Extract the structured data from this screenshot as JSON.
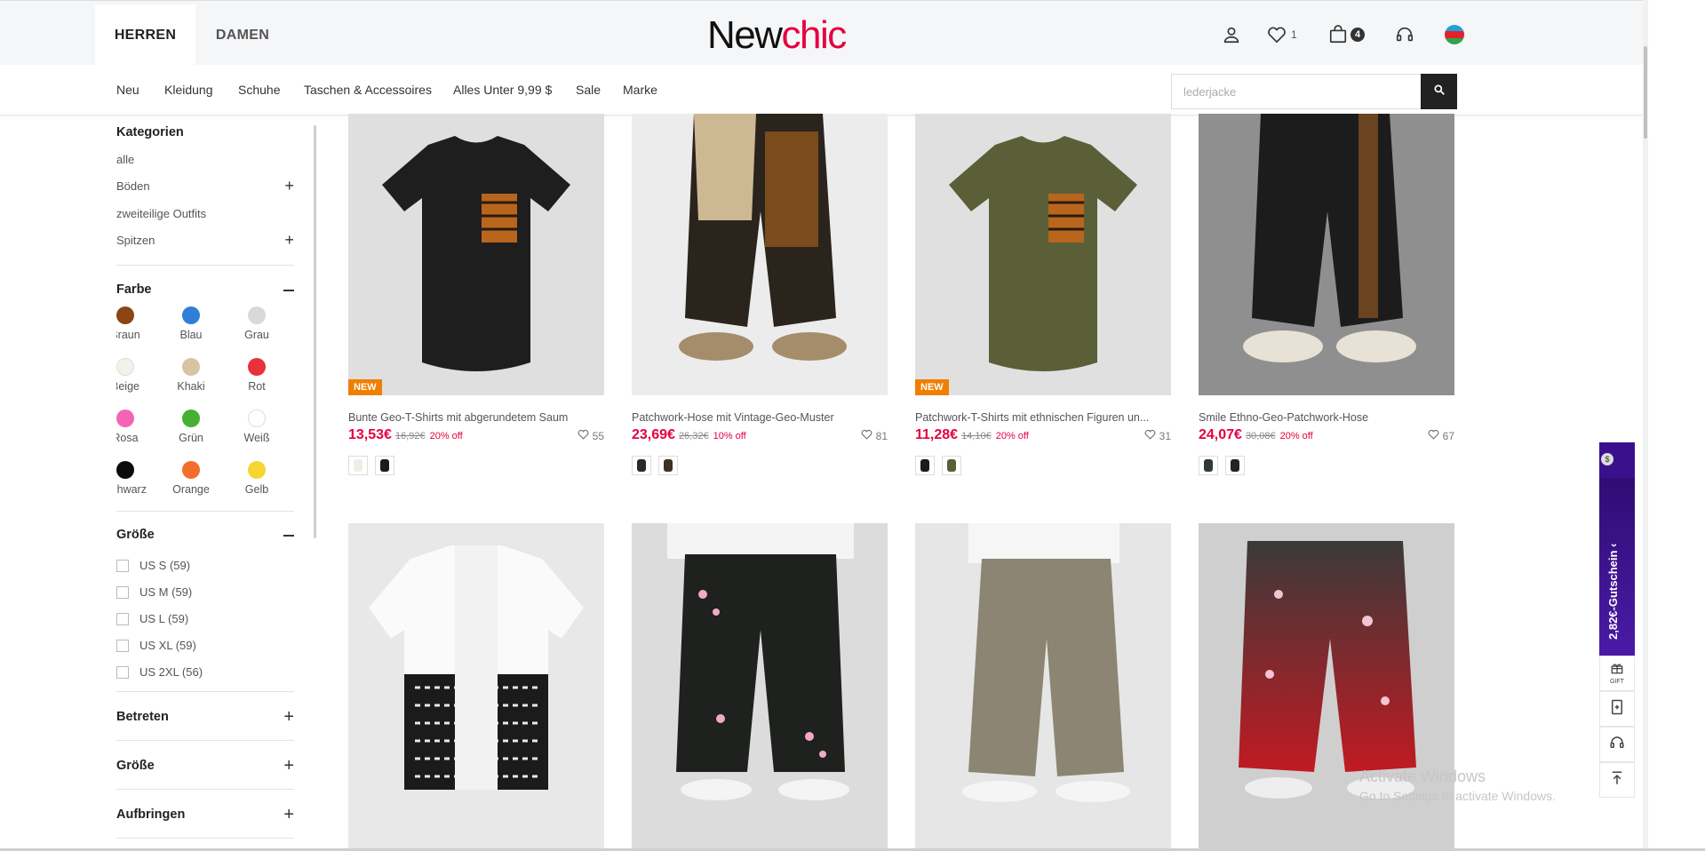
{
  "header": {
    "gender_tabs": [
      {
        "label": "HERREN",
        "active": true
      },
      {
        "label": "DAMEN",
        "active": false
      }
    ],
    "logo": {
      "part1": "New",
      "part2": "chic"
    },
    "wishlist_count": "1",
    "cart_count": "4",
    "icons": [
      "user-icon",
      "heart-icon",
      "bag-icon",
      "headset-icon",
      "flag-icon"
    ]
  },
  "nav": {
    "items": [
      "Neu",
      "Kleidung",
      "Schuhe",
      "Taschen & Accessoires",
      "Alles Unter 9,99 $",
      "Sale",
      "Marke"
    ],
    "search_placeholder": "lederjacke"
  },
  "sidebar": {
    "categories_title": "Kategorien",
    "categories": [
      {
        "label": "alle",
        "expandable": false
      },
      {
        "label": "Böden",
        "expandable": true
      },
      {
        "label": "zweiteilige Outfits",
        "expandable": false
      },
      {
        "label": "Spitzen",
        "expandable": true
      }
    ],
    "color_title": "Farbe",
    "colors": [
      {
        "label": "Braun",
        "hex": "#8b4513"
      },
      {
        "label": "Blau",
        "hex": "#2f7ed8"
      },
      {
        "label": "Grau",
        "hex": "#d9d9d9"
      },
      {
        "label": "Beige",
        "hex": "#f3f1ea"
      },
      {
        "label": "Khaki",
        "hex": "#d8c4a3"
      },
      {
        "label": "Rot",
        "hex": "#e8313b"
      },
      {
        "label": "Rosa",
        "hex": "#f564b4"
      },
      {
        "label": "Grün",
        "hex": "#46b035"
      },
      {
        "label": "Weiß",
        "hex": "#ffffff"
      },
      {
        "label": "Schwarz",
        "hex": "#0b0b0b"
      },
      {
        "label": "Orange",
        "hex": "#f36e2a"
      },
      {
        "label": "Gelb",
        "hex": "#f6d633"
      }
    ],
    "size_title": "Größe",
    "sizes": [
      "US S (59)",
      "US M (59)",
      "US L (59)",
      "US XL (59)",
      "US 2XL (56)"
    ],
    "collapsed_sections": [
      "Betreten",
      "Größe",
      "Aufbringen"
    ]
  },
  "products": [
    {
      "title": "Bunte Geo-T-Shirts mit abgerundetem Saum",
      "price": "13,53€",
      "old_price": "16,92€",
      "discount": "20% off",
      "likes": "55",
      "badge": "NEW",
      "image": "black-tshirt-tribal-pocket",
      "bg": "#dfdfdf",
      "thumbs": [
        "#f0ede6",
        "#1a1a1a"
      ]
    },
    {
      "title": "Patchwork-Hose mit Vintage-Geo-Muster",
      "price": "23,69€",
      "old_price": "26,32€",
      "discount": "10% off",
      "likes": "81",
      "badge": "",
      "image": "patchwork-jogger-pants",
      "bg": "#ececec",
      "thumbs": [
        "#2a2a2a",
        "#3b3125"
      ]
    },
    {
      "title": "Patchwork-T-Shirts mit ethnischen Figuren un...",
      "price": "11,28€",
      "old_price": "14,10€",
      "discount": "20% off",
      "likes": "31",
      "badge": "NEW",
      "image": "olive-tshirt-ethnic-pocket",
      "bg": "#e0e0e0",
      "thumbs": [
        "#1b1b1b",
        "#5b5f33"
      ]
    },
    {
      "title": "Smile Ethno-Geo-Patchwork-Hose",
      "price": "24,07€",
      "old_price": "30,08€",
      "discount": "20% off",
      "likes": "67",
      "badge": "",
      "image": "black-jogger-side-stripe",
      "bg": "#8f8f8f",
      "thumbs": [
        "#2f3a33",
        "#232323"
      ]
    },
    {
      "title": "",
      "price": "",
      "old_price": "",
      "discount": "",
      "likes": "",
      "badge": "",
      "image": "egyptian-print-shirt",
      "bg": "#e8e8e8",
      "thumbs": []
    },
    {
      "title": "",
      "price": "",
      "old_price": "",
      "discount": "",
      "likes": "",
      "badge": "",
      "image": "cherry-blossom-black-pants",
      "bg": "#dcdcdc",
      "thumbs": []
    },
    {
      "title": "",
      "price": "",
      "old_price": "",
      "discount": "",
      "likes": "",
      "badge": "",
      "image": "linen-jogger-pants",
      "bg": "#e6e6e6",
      "thumbs": []
    },
    {
      "title": "",
      "price": "",
      "old_price": "",
      "discount": "",
      "likes": "",
      "badge": "",
      "image": "red-gradient-blossom-pants",
      "bg": "#cfcfcf",
      "thumbs": []
    }
  ],
  "floating": {
    "coupon_label": "2,82€-Gutschein ‹",
    "coupon_icon_text": "$",
    "gift_label": "GIFT"
  },
  "windows_watermark": {
    "line1": "Activate Windows",
    "line2": "Go to Settings to activate Windows."
  }
}
